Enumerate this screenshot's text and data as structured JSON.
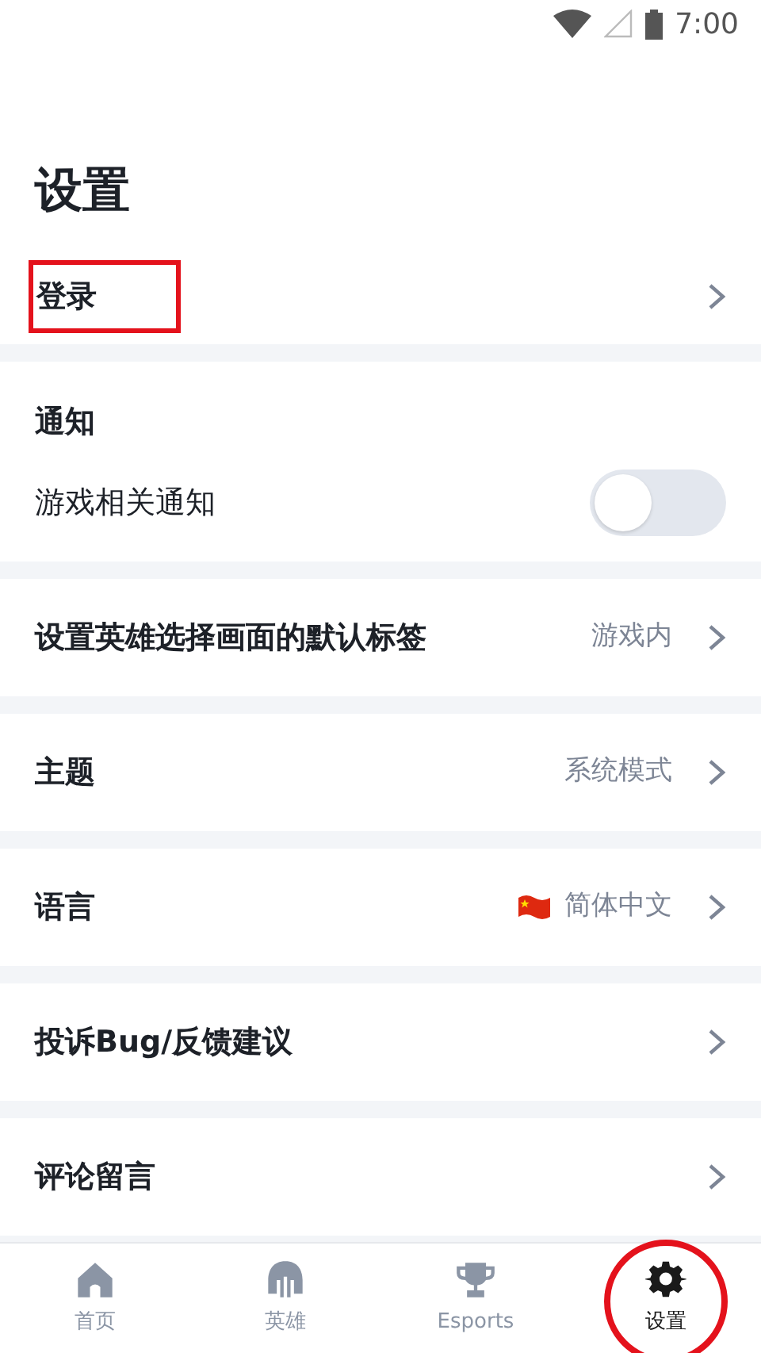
{
  "status_bar": {
    "time": "7:00"
  },
  "title": "设置",
  "sections": [
    {
      "items": [
        {
          "kind": "link",
          "label": "登录",
          "highlighted": true
        }
      ]
    },
    {
      "items": [
        {
          "kind": "header",
          "label": "通知"
        },
        {
          "kind": "toggle",
          "label": "游戏相关通知",
          "on": false
        }
      ]
    },
    {
      "items": [
        {
          "kind": "link",
          "label": "设置英雄选择画面的默认标签",
          "value": "游戏内",
          "highlighted": false
        }
      ]
    },
    {
      "items": [
        {
          "kind": "link",
          "label": "主题",
          "value": "系统模式",
          "highlighted": false
        }
      ]
    },
    {
      "items": [
        {
          "kind": "flag_link",
          "label": "语言",
          "value": "简体中文",
          "highlighted": false
        }
      ]
    },
    {
      "items": [
        {
          "kind": "link",
          "label": "投诉Bug/反馈建议",
          "highlighted": false
        }
      ]
    },
    {
      "items": [
        {
          "kind": "link",
          "label": "评论留言",
          "highlighted": false
        }
      ]
    }
  ],
  "nav": [
    {
      "label": "首页",
      "selected": false,
      "highlighted": false
    },
    {
      "label": "英雄",
      "selected": false,
      "highlighted": false
    },
    {
      "label": "Esports",
      "selected": false,
      "highlighted": false
    },
    {
      "label": "设置",
      "selected": true,
      "highlighted": true
    }
  ]
}
